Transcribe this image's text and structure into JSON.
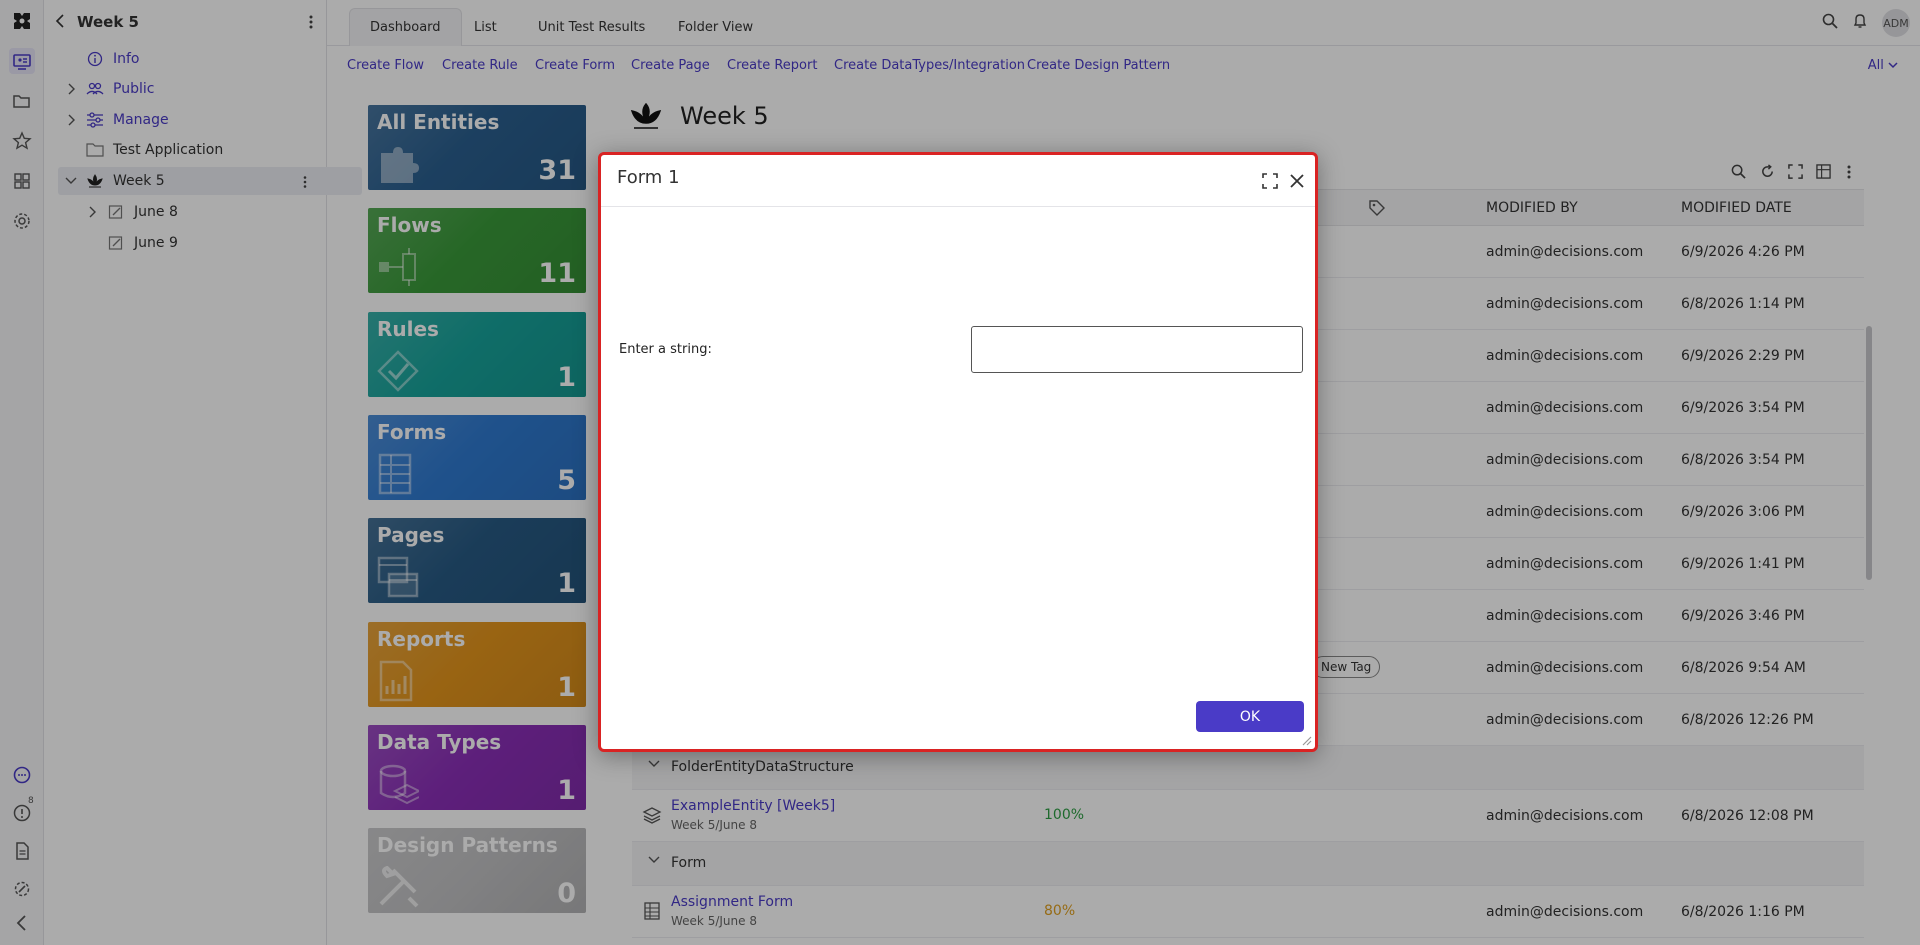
{
  "tree": {
    "title": "Week 5",
    "items": [
      {
        "label": "Info",
        "icon": "info-icon"
      },
      {
        "label": "Public",
        "icon": "people-icon"
      },
      {
        "label": "Manage",
        "icon": "sliders-icon"
      },
      {
        "label": "Test Application",
        "icon": "folder-icon"
      },
      {
        "label": "Week 5",
        "icon": "lotus-icon"
      },
      {
        "label": "June 8",
        "icon": "edit-doc-icon"
      },
      {
        "label": "June 9",
        "icon": "edit-doc-icon"
      }
    ]
  },
  "rail": {
    "badge": "8"
  },
  "topbar": {
    "tabs": [
      "Dashboard",
      "List",
      "Unit Test Results",
      "Folder View"
    ],
    "avatar": "ADM"
  },
  "actions": {
    "items": [
      "Create Flow",
      "Create Rule",
      "Create Form",
      "Create Page",
      "Create Report",
      "Create DataTypes/Integration",
      "Create Design Pattern"
    ],
    "filter": "All"
  },
  "tiles": [
    {
      "name": "All Entities",
      "count": "31",
      "color": "#2a5f8f"
    },
    {
      "name": "Flows",
      "count": "11",
      "color": "#3a9a3a"
    },
    {
      "name": "Rules",
      "count": "1",
      "color": "#17a39b"
    },
    {
      "name": "Forms",
      "count": "5",
      "color": "#2f7ad0"
    },
    {
      "name": "Pages",
      "count": "1",
      "color": "#275a84"
    },
    {
      "name": "Reports",
      "count": "1",
      "color": "#e4951c"
    },
    {
      "name": "Data Types",
      "count": "1",
      "color": "#8b2fb8"
    },
    {
      "name": "Design Patterns",
      "count": "0",
      "color": "#c2c2c4"
    }
  ],
  "page": {
    "title": "Week 5"
  },
  "grid": {
    "headers": {
      "modified_by": "MODIFIED BY",
      "modified_date": "MODIFIED DATE"
    },
    "rows": [
      {
        "by": "admin@decisions.com",
        "date": "6/9/2026 4:26 PM"
      },
      {
        "by": "admin@decisions.com",
        "date": "6/8/2026 1:14 PM"
      },
      {
        "by": "admin@decisions.com",
        "date": "6/9/2026 2:29 PM"
      },
      {
        "by": "admin@decisions.com",
        "date": "6/9/2026 3:54 PM"
      },
      {
        "by": "admin@decisions.com",
        "date": "6/8/2026 3:54 PM"
      },
      {
        "by": "admin@decisions.com",
        "date": "6/9/2026 3:06 PM"
      },
      {
        "by": "admin@decisions.com",
        "date": "6/9/2026 1:41 PM"
      },
      {
        "by": "admin@decisions.com",
        "date": "6/9/2026 3:46 PM"
      },
      {
        "by": "admin@decisions.com",
        "date": "6/8/2026 9:54 AM",
        "tag": "New Tag"
      },
      {
        "by": "admin@decisions.com",
        "date": "6/8/2026 12:26 PM"
      }
    ],
    "groups": [
      {
        "label": "FolderEntityDataStructure",
        "entity": {
          "name": "ExampleEntity [Week5]",
          "path": "Week 5/June 8",
          "pct": "100%",
          "pct_color": "#2e9e44",
          "by": "admin@decisions.com",
          "date": "6/8/2026 12:08 PM"
        }
      },
      {
        "label": "Form",
        "entity": {
          "name": "Assignment Form",
          "path": "Week 5/June 8",
          "pct": "80%",
          "pct_color": "#e0a020",
          "by": "admin@decisions.com",
          "date": "6/8/2026 1:16 PM"
        }
      }
    ]
  },
  "modal": {
    "title": "Form 1",
    "field_label": "Enter a string:",
    "field_value": "",
    "ok_label": "OK"
  }
}
